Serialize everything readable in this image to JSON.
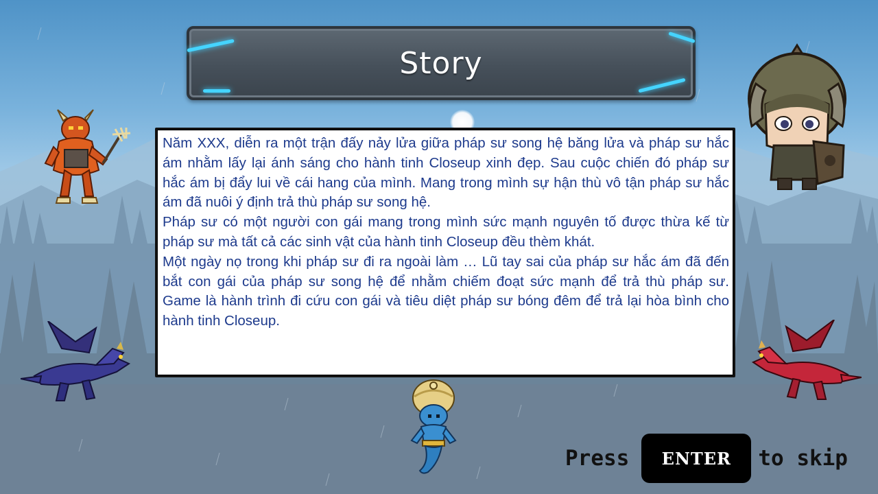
{
  "title": "Story",
  "story": {
    "paragraphs": [
      "Năm XXX, diễn ra một trận đấy nảy lửa giữa pháp sư song hệ băng lửa và pháp sư hắc ám nhằm lấy lại ánh sáng cho hành tinh Closeup xinh đẹp. Sau cuộc chiến đó pháp sư hắc ám bị đẩy lui về cái hang của mình. Mang trong mình sự hận thù vô tận pháp sư hắc ám đã nuôi ý định trả thù pháp sư song hệ.",
      "Pháp sư có một người con gái mang trong mình sức mạnh nguyên tố được thừa kế từ pháp sư mà tất cả các sinh vật của hành tinh Closeup đều thèm khát.",
      "Một ngày nọ trong khi pháp sư đi ra ngoài làm … Lũ tay sai của pháp sư hắc ám đã đến bắt con gái của pháp sư song hệ để nhằm chiếm đoạt sức mạnh để trả thù pháp sư. Game là hành trình đi cứu con gái và tiêu diệt pháp sư bóng đêm để trả lại hòa bình cho hành tinh Closeup."
    ]
  },
  "prompt": {
    "press": "Press",
    "key": "ENTER",
    "action": "to skip"
  },
  "colors": {
    "story_text": "#1d3a8c",
    "glow": "#45d4ff"
  },
  "sprites": [
    "red-demon-icon",
    "helmet-warrior-icon",
    "blue-dragon-icon",
    "red-dragon-icon",
    "genie-icon"
  ]
}
